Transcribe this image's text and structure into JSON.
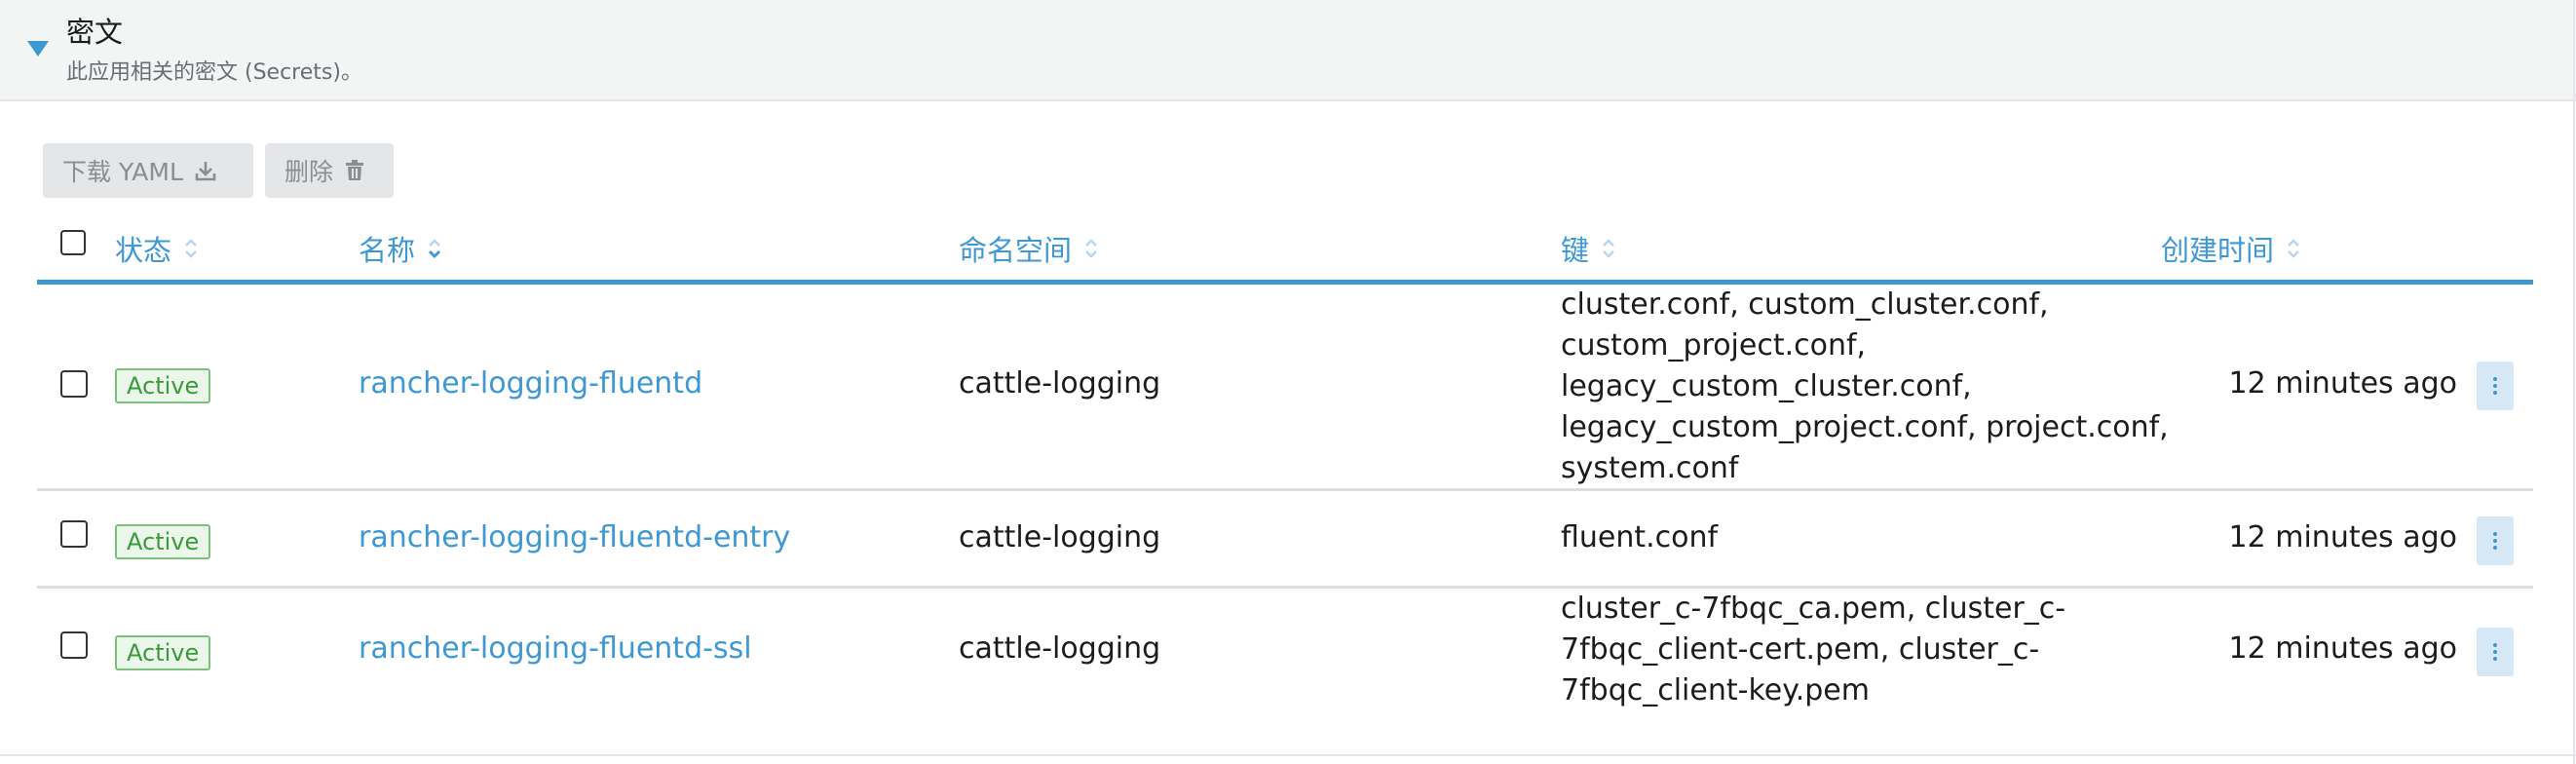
{
  "section": {
    "title": "密文",
    "subtitle": "此应用相关的密文 (Secrets)。"
  },
  "actions": {
    "download_label": "下载 YAML",
    "download_icon": "download-icon",
    "delete_label": "删除",
    "delete_icon": "trash-icon"
  },
  "table": {
    "columns": {
      "state": "状态",
      "name": "名称",
      "namespace": "命名空间",
      "keys": "键",
      "created": "创建时间"
    },
    "sorted_column": "name",
    "rows": [
      {
        "state": "Active",
        "name": "rancher-logging-fluentd",
        "namespace": "cattle-logging",
        "keys": "cluster.conf, custom_cluster.conf, custom_project.conf, legacy_custom_cluster.conf, legacy_custom_project.conf, project.conf, system.conf",
        "created": "12 minutes ago"
      },
      {
        "state": "Active",
        "name": "rancher-logging-fluentd-entry",
        "namespace": "cattle-logging",
        "keys": "fluent.conf",
        "created": "12 minutes ago"
      },
      {
        "state": "Active",
        "name": "rancher-logging-fluentd-ssl",
        "namespace": "cattle-logging",
        "keys": "cluster_c-7fbqc_ca.pem, cluster_c-7fbqc_client-cert.pem, cluster_c-7fbqc_client-key.pem",
        "created": "12 minutes ago"
      }
    ]
  },
  "colors": {
    "accent": "#3d98d3",
    "header_bg": "#f3f4f4",
    "active_green": "#3a9a3a",
    "button_bg": "#e4e6e8"
  }
}
